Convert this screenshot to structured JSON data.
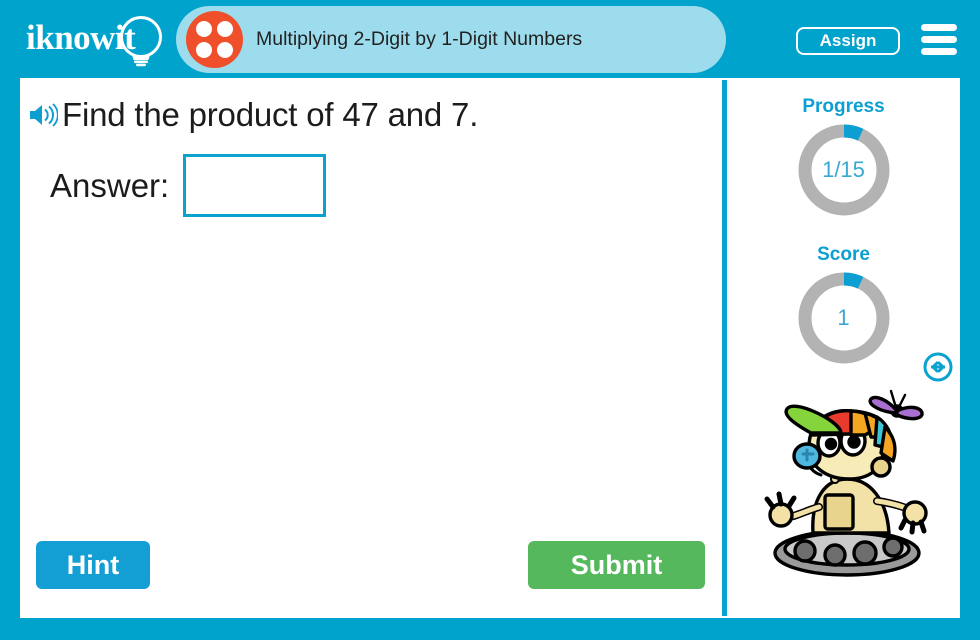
{
  "app": {
    "brand": "iknowit",
    "accent_blue": "#00a3cc",
    "pill_blue": "#9cdced",
    "orange": "#f04f2c",
    "green": "#55b85c",
    "ring_track": "#b3b3b3"
  },
  "header": {
    "logo_text": "iknowit",
    "logo_icon": "lightbulb-icon",
    "dots_icon": "four-dots-icon",
    "title": "Multiplying 2-Digit by 1-Digit Numbers",
    "assign_label": "Assign",
    "menu_icon": "hamburger-menu-icon"
  },
  "question": {
    "speaker_icon": "speaker-audio-icon",
    "text": "Find the product of 47 and 7.",
    "answer_label": "Answer:",
    "answer_value": "",
    "answer_placeholder": ""
  },
  "actions": {
    "hint_label": "Hint",
    "submit_label": "Submit"
  },
  "panel": {
    "progress": {
      "label": "Progress",
      "value": "1/15",
      "current": 1,
      "total": 15,
      "percent": 7
    },
    "score": {
      "label": "Score",
      "value": "1",
      "current": 1,
      "percent": 7
    },
    "mascot_icon": "robot-mascot-propeller-hat",
    "resize_icon": "horizontal-resize-arrows-icon"
  }
}
